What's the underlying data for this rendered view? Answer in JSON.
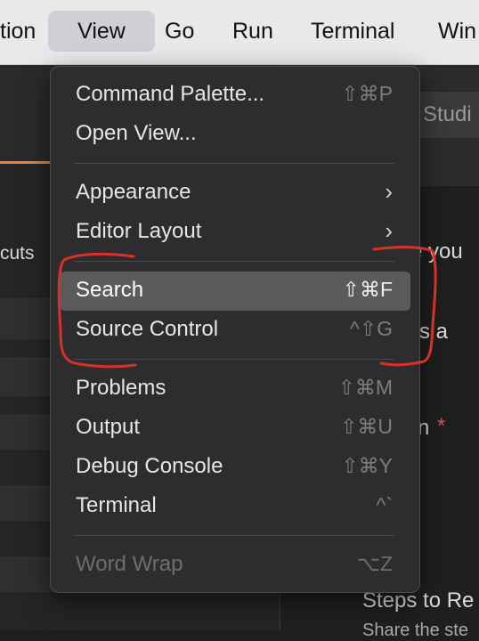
{
  "menubar": {
    "items": [
      "tion",
      "View",
      "Go",
      "Run",
      "Terminal",
      "Win"
    ],
    "active_index": 1
  },
  "background": {
    "left_text": "cuts",
    "tab_text": "Studi",
    "right_fragments": [
      "e you",
      "s a",
      "n",
      "Steps to Re",
      "Share the ste"
    ],
    "required_star": "*"
  },
  "menu": {
    "groups": [
      [
        {
          "label": "Command Palette...",
          "shortcut": "⇧⌘P"
        },
        {
          "label": "Open View...",
          "shortcut": ""
        }
      ],
      [
        {
          "label": "Appearance",
          "submenu": true,
          "arrow": "›"
        },
        {
          "label": "Editor Layout",
          "submenu": true,
          "arrow": "›"
        }
      ],
      [
        {
          "label": "Search",
          "shortcut": "⇧⌘F",
          "highlighted": true
        },
        {
          "label": "Source Control",
          "shortcut": "^⇧G"
        }
      ],
      [
        {
          "label": "Problems",
          "shortcut": "⇧⌘M"
        },
        {
          "label": "Output",
          "shortcut": "⇧⌘U"
        },
        {
          "label": "Debug Console",
          "shortcut": "⇧⌘Y"
        },
        {
          "label": "Terminal",
          "shortcut": "^`"
        }
      ],
      [
        {
          "label": "Word Wrap",
          "shortcut": "⌥Z",
          "disabled": true
        }
      ]
    ]
  },
  "annotation": {
    "color": "#d8302a"
  }
}
